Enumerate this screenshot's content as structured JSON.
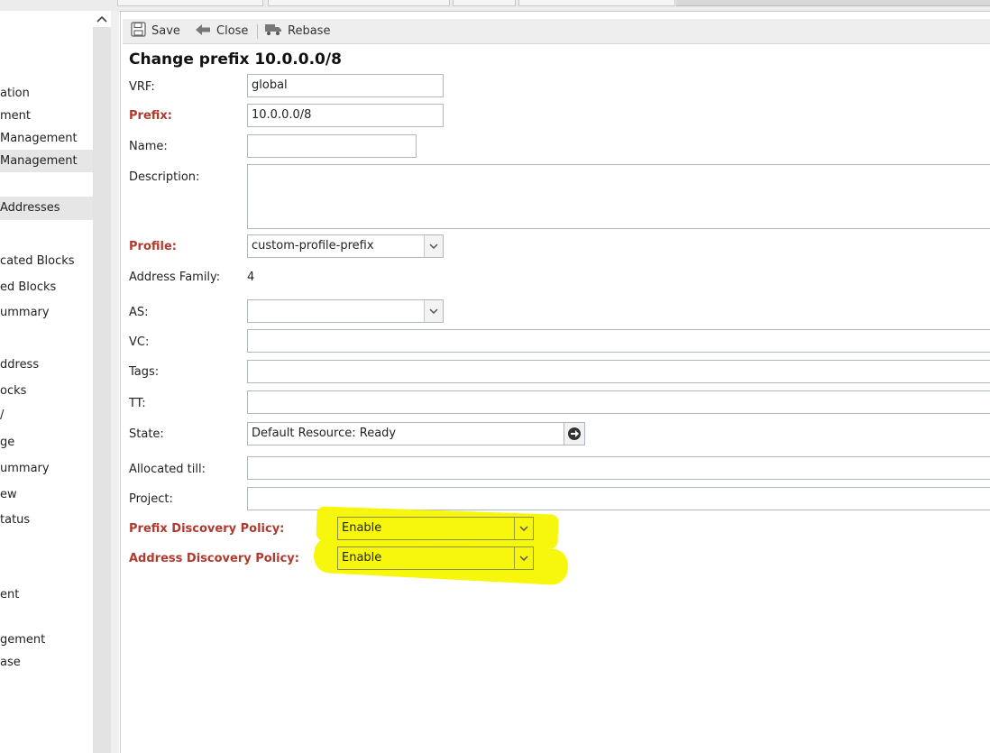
{
  "sidebar": {
    "items": [
      {
        "label": "ation"
      },
      {
        "label": "ment"
      },
      {
        "label": " Management"
      },
      {
        "label": " Management"
      },
      {
        "label": "Addresses"
      },
      {
        "label": "cated Blocks"
      },
      {
        "label": "ed Blocks"
      },
      {
        "label": "ummary"
      },
      {
        "label": "ddress"
      },
      {
        "label": "ocks"
      },
      {
        "label": "/"
      },
      {
        "label": "ge"
      },
      {
        "label": "ummary"
      },
      {
        "label": "ew"
      },
      {
        "label": "tatus"
      },
      {
        "label": "ent"
      },
      {
        "label": "gement"
      },
      {
        "label": "ase"
      }
    ],
    "scroll_up_icon": "chevron-up-icon"
  },
  "toolbar": {
    "save_label": "Save",
    "close_label": "Close",
    "rebase_label": "Rebase",
    "icons": [
      "floppy-disk-icon",
      "arrow-left-icon",
      "truck-icon"
    ]
  },
  "form": {
    "title": "Change prefix 10.0.0.0/8",
    "vrf": {
      "label": "VRF:",
      "value": "global"
    },
    "prefix": {
      "label": "Prefix:",
      "value": "10.0.0.0/8"
    },
    "name": {
      "label": "Name:",
      "value": ""
    },
    "description": {
      "label": "Description:",
      "value": ""
    },
    "profile": {
      "label": "Profile:",
      "value": "custom-profile-prefix"
    },
    "address_family": {
      "label": "Address Family:",
      "value": "4"
    },
    "as": {
      "label": "AS:",
      "value": ""
    },
    "vc": {
      "label": "VC:",
      "value": ""
    },
    "tags": {
      "label": "Tags:",
      "value": ""
    },
    "tt": {
      "label": "TT:",
      "value": ""
    },
    "state": {
      "label": "State:",
      "value": "Default Resource: Ready",
      "go_icon": "arrow-right-circle-icon"
    },
    "allocated_till": {
      "label": "Allocated till:",
      "value": ""
    },
    "project": {
      "label": "Project:",
      "value": ""
    },
    "prefix_discovery_policy": {
      "label": "Prefix Discovery Policy:",
      "value": "Enable"
    },
    "address_discovery_policy": {
      "label": "Address Discovery Policy:",
      "value": "Enable"
    }
  },
  "colors": {
    "required_label": "#b03a2e",
    "highlight": "#f7f700",
    "toolbar_bg": "#eeeeee",
    "selected_item_bg": "#e6e6e6"
  }
}
